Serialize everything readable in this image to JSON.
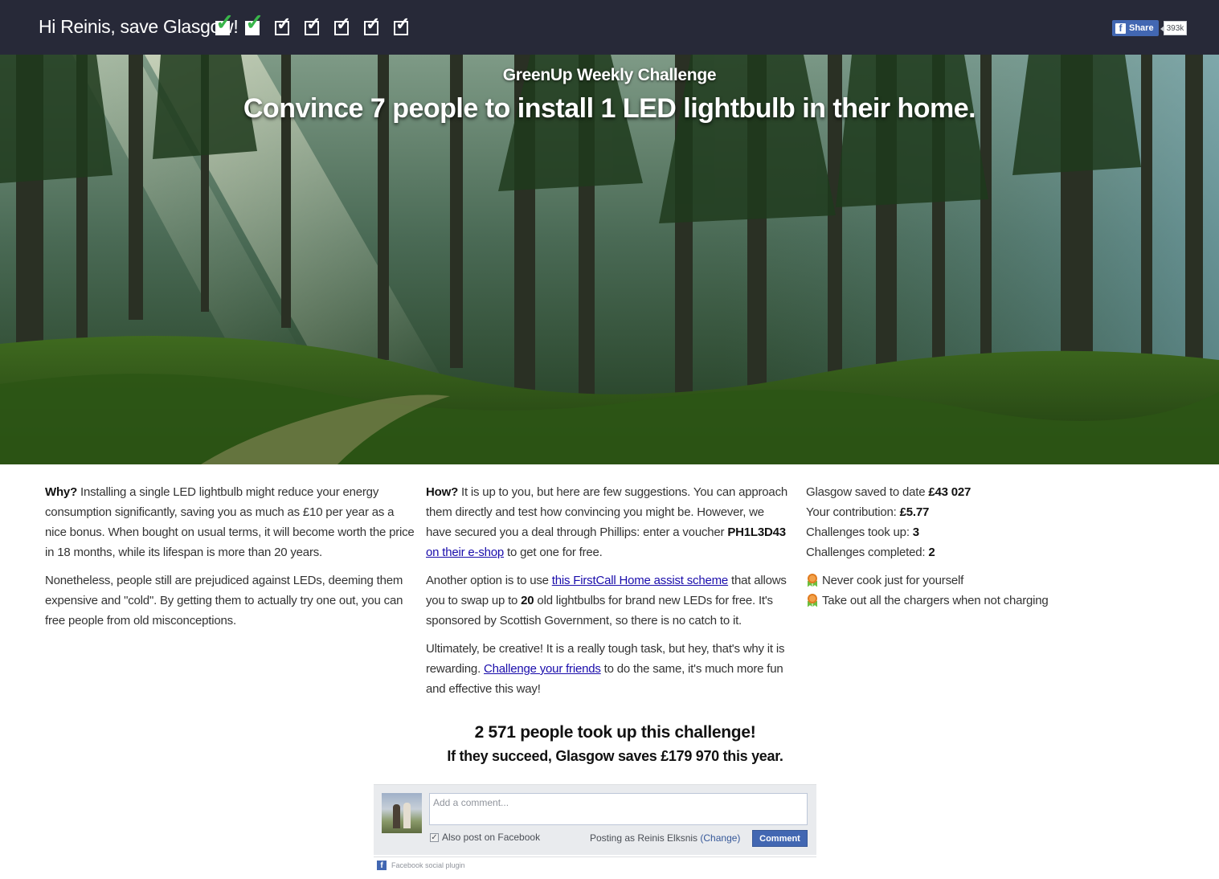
{
  "topbar": {
    "greeting": "Hi Reinis, save Glasgow!",
    "checks": [
      true,
      true,
      false,
      false,
      false,
      false,
      false
    ],
    "share_label": "Share",
    "share_count": "393k"
  },
  "hero": {
    "subtitle": "GreenUp Weekly Challenge",
    "title": "Convince 7 people to install 1 LED lightbulb in their home."
  },
  "why": {
    "lead": "Why?",
    "text1": " Installing a single LED lightbulb might reduce your energy consumption significantly, saving you as much as £10 per year as a nice bonus. When bought on usual terms, it will become worth the price in 18 months, while its lifespan is more than 20 years.",
    "text2": "Nonetheless, people still are prejudiced against LEDs, deeming them expensive and \"cold\". By getting them to actually try one out, you can free people from old misconceptions."
  },
  "how": {
    "lead": "How?",
    "p1_a": " It is up to you, but here are few suggestions. You can approach them directly and test how convincing you might be. However, we have secured you a deal through Phillips: enter a voucher ",
    "voucher": "PH1L3D43",
    "p1_link": "on their e-shop",
    "p1_b": " to get one for free.",
    "p2_a": "Another option is to use ",
    "p2_link": "this FirstCall Home assist scheme",
    "p2_b": " that allows you to swap up to ",
    "p2_num": "20",
    "p2_c": " old lightbulbs for brand new LEDs for free. It's sponsored by Scottish Government, so there is no catch to it.",
    "p3_a": "Ultimately, be creative! It is a really tough task, but hey, that's why it is rewarding. ",
    "p3_link": "Challenge your friends",
    "p3_b": " to do the same, it's much more fun and effective this way!"
  },
  "stats": {
    "saved_label": "Glasgow saved to date ",
    "saved_value": "£43 027",
    "contrib_label": "Your contribution: ",
    "contrib_value": "£5.77",
    "took_label": "Challenges took up: ",
    "took_value": "3",
    "completed_label": "Challenges completed: ",
    "completed_value": "2",
    "tips": [
      "Never cook just for yourself",
      "Take out all the chargers when not charging"
    ]
  },
  "summary": {
    "line1": "2 571 people took up this challenge!",
    "line2": "If they succeed, Glasgow saves £179 970 this year."
  },
  "comments": {
    "placeholder": "Add a comment...",
    "also_post": "Also post on Facebook",
    "posting_as": "Posting as Reinis Elksnis ",
    "change": "(Change)",
    "button": "Comment",
    "plugin": "Facebook social plugin"
  },
  "colors": {
    "topbar": "#272938",
    "facebook": "#4267b2",
    "link": "#1a0dab",
    "check_done": "#39b54a"
  }
}
